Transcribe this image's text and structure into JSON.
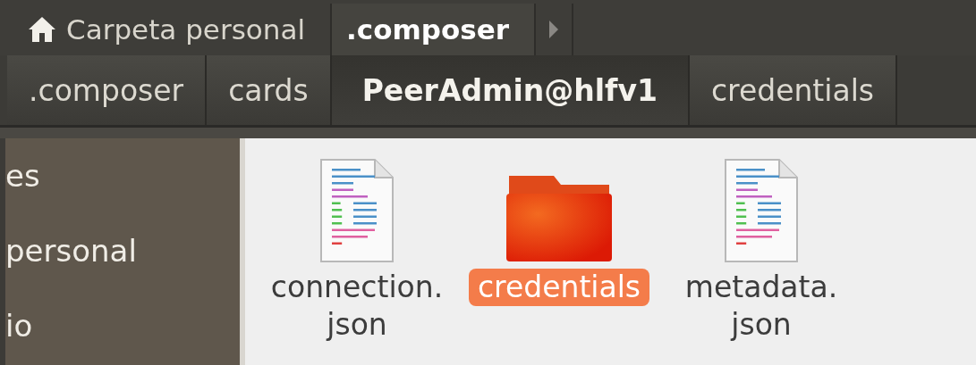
{
  "path_bar": [
    {
      "kind": "home",
      "label": "Carpeta personal",
      "selected": false
    },
    {
      "kind": "folder",
      "label": ".composer",
      "selected": true
    }
  ],
  "breadcrumb": [
    {
      "label": ".composer",
      "selected": false
    },
    {
      "label": "cards",
      "selected": false
    },
    {
      "label": "PeerAdmin@hlfv1",
      "selected": true
    },
    {
      "label": "credentials",
      "selected": false
    }
  ],
  "sidebar": {
    "items": [
      {
        "label": "es"
      },
      {
        "label": "personal"
      },
      {
        "label": "io"
      }
    ]
  },
  "files": [
    {
      "kind": "document",
      "name_lines": [
        "connection.",
        "json"
      ],
      "selected": false
    },
    {
      "kind": "folder",
      "name_lines": [
        "credentials"
      ],
      "selected": true
    },
    {
      "kind": "document",
      "name_lines": [
        "metadata.",
        "json"
      ],
      "selected": false
    }
  ]
}
